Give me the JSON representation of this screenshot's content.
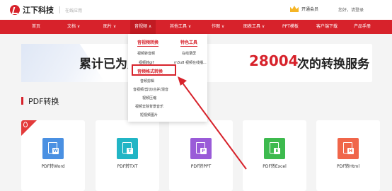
{
  "header": {
    "logo_text": "江下科技",
    "logo_sub": "在线应用",
    "vip_label": "开通会员",
    "greeting": "您好，请登录"
  },
  "navbar": {
    "items": [
      "首页",
      "文档",
      "图片",
      "音视频",
      "其他工具",
      "作图",
      "图表工具",
      "PPT模板",
      "客户端下载",
      "产品手册"
    ],
    "active_index": 3
  },
  "banner": {
    "prefix": "累计已为广",
    "count": "28004",
    "suffix": "次的转换服务"
  },
  "dropdown": {
    "col1_heading": "音视频转换",
    "col2_heading": "特色工具",
    "col1_items": [
      "视频转音频",
      "视频转gif",
      "音频格式转换",
      "音频剪辑",
      "音视频/剪切/合并/混音",
      "视频压缩",
      "视频去除背景音乐",
      "短视频图片"
    ],
    "col2_items": [
      "在线录屏",
      "m3u8 视频在线播..."
    ],
    "highlighted": "音频格式转换"
  },
  "section": {
    "title": "PDF转换"
  },
  "cards": [
    {
      "label": "PDF转Word",
      "badge": "W",
      "color": "#4a90e2"
    },
    {
      "label": "PDF转TXT",
      "badge": "T",
      "color": "#21b5c5"
    },
    {
      "label": "PDF转PPT",
      "badge": "P",
      "color": "#9a5bd8"
    },
    {
      "label": "PDF转Excel",
      "badge": "E",
      "color": "#3dba4e"
    },
    {
      "label": "PDF转Html",
      "badge": "H",
      "color": "#f0664a"
    }
  ],
  "colors": {
    "brand_red": "#d7222b"
  }
}
